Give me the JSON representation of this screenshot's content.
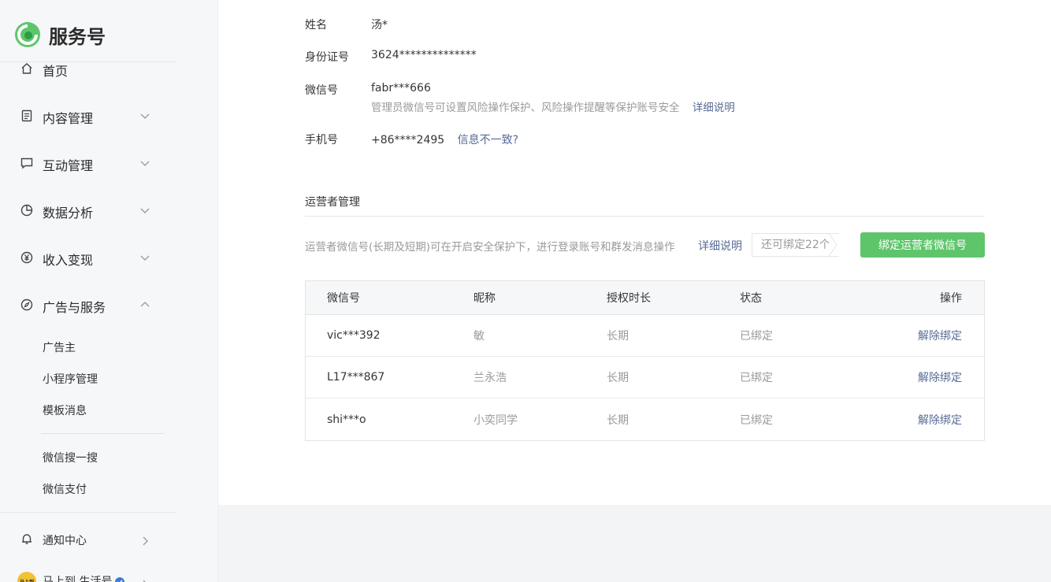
{
  "brand": {
    "name": "服务号",
    "logo_icon": "wechat-service-logo"
  },
  "sidebar": {
    "items": [
      {
        "label": "首页",
        "icon": "home-icon",
        "expanded": null
      },
      {
        "label": "内容管理",
        "icon": "document-icon",
        "expanded": false
      },
      {
        "label": "互动管理",
        "icon": "chat-icon",
        "expanded": false
      },
      {
        "label": "数据分析",
        "icon": "pie-chart-icon",
        "expanded": false
      },
      {
        "label": "收入变现",
        "icon": "yen-icon",
        "expanded": false
      },
      {
        "label": "广告与服务",
        "icon": "compass-icon",
        "expanded": true
      }
    ],
    "sub_items": [
      "广告主",
      "小程序管理",
      "模板消息",
      "微信搜一搜",
      "微信支付"
    ],
    "notification": {
      "label": "通知中心",
      "icon": "bell-icon"
    },
    "account": {
      "label": "马上到 生活号",
      "avatar_text": "马上到"
    }
  },
  "profile": {
    "name_label": "姓名",
    "name_value": "汤*",
    "id_label": "身份证号",
    "id_value": "3624**************",
    "wechat_label": "微信号",
    "wechat_value": "fabr***666",
    "wechat_hint": "管理员微信号可设置风险操作保护、风险操作提醒等保护账号安全",
    "wechat_hint_link": "详细说明",
    "phone_label": "手机号",
    "phone_value": "+86****2495",
    "phone_link": "信息不一致?"
  },
  "operators": {
    "title": "运营者管理",
    "description": "运营者微信号(长期及短期)可在开启安全保护下，进行登录账号和群发消息操作",
    "description_link": "详细说明",
    "remaining": "还可绑定22个",
    "bind_button": "绑定运营者微信号",
    "columns": [
      "微信号",
      "昵称",
      "授权时长",
      "状态",
      "操作"
    ],
    "rows": [
      {
        "wechat": "vic***392",
        "nickname": "敏",
        "duration": "长期",
        "status": "已绑定",
        "action": "解除绑定"
      },
      {
        "wechat": "L17***867",
        "nickname": "兰永浩",
        "duration": "长期",
        "status": "已绑定",
        "action": "解除绑定"
      },
      {
        "wechat": "shi***o",
        "nickname": "小奕同学",
        "duration": "长期",
        "status": "已绑定",
        "action": "解除绑定"
      }
    ]
  },
  "colors": {
    "accent_green": "#5fc56b",
    "link_blue": "#576b95",
    "muted_text": "#9a9a9a"
  }
}
